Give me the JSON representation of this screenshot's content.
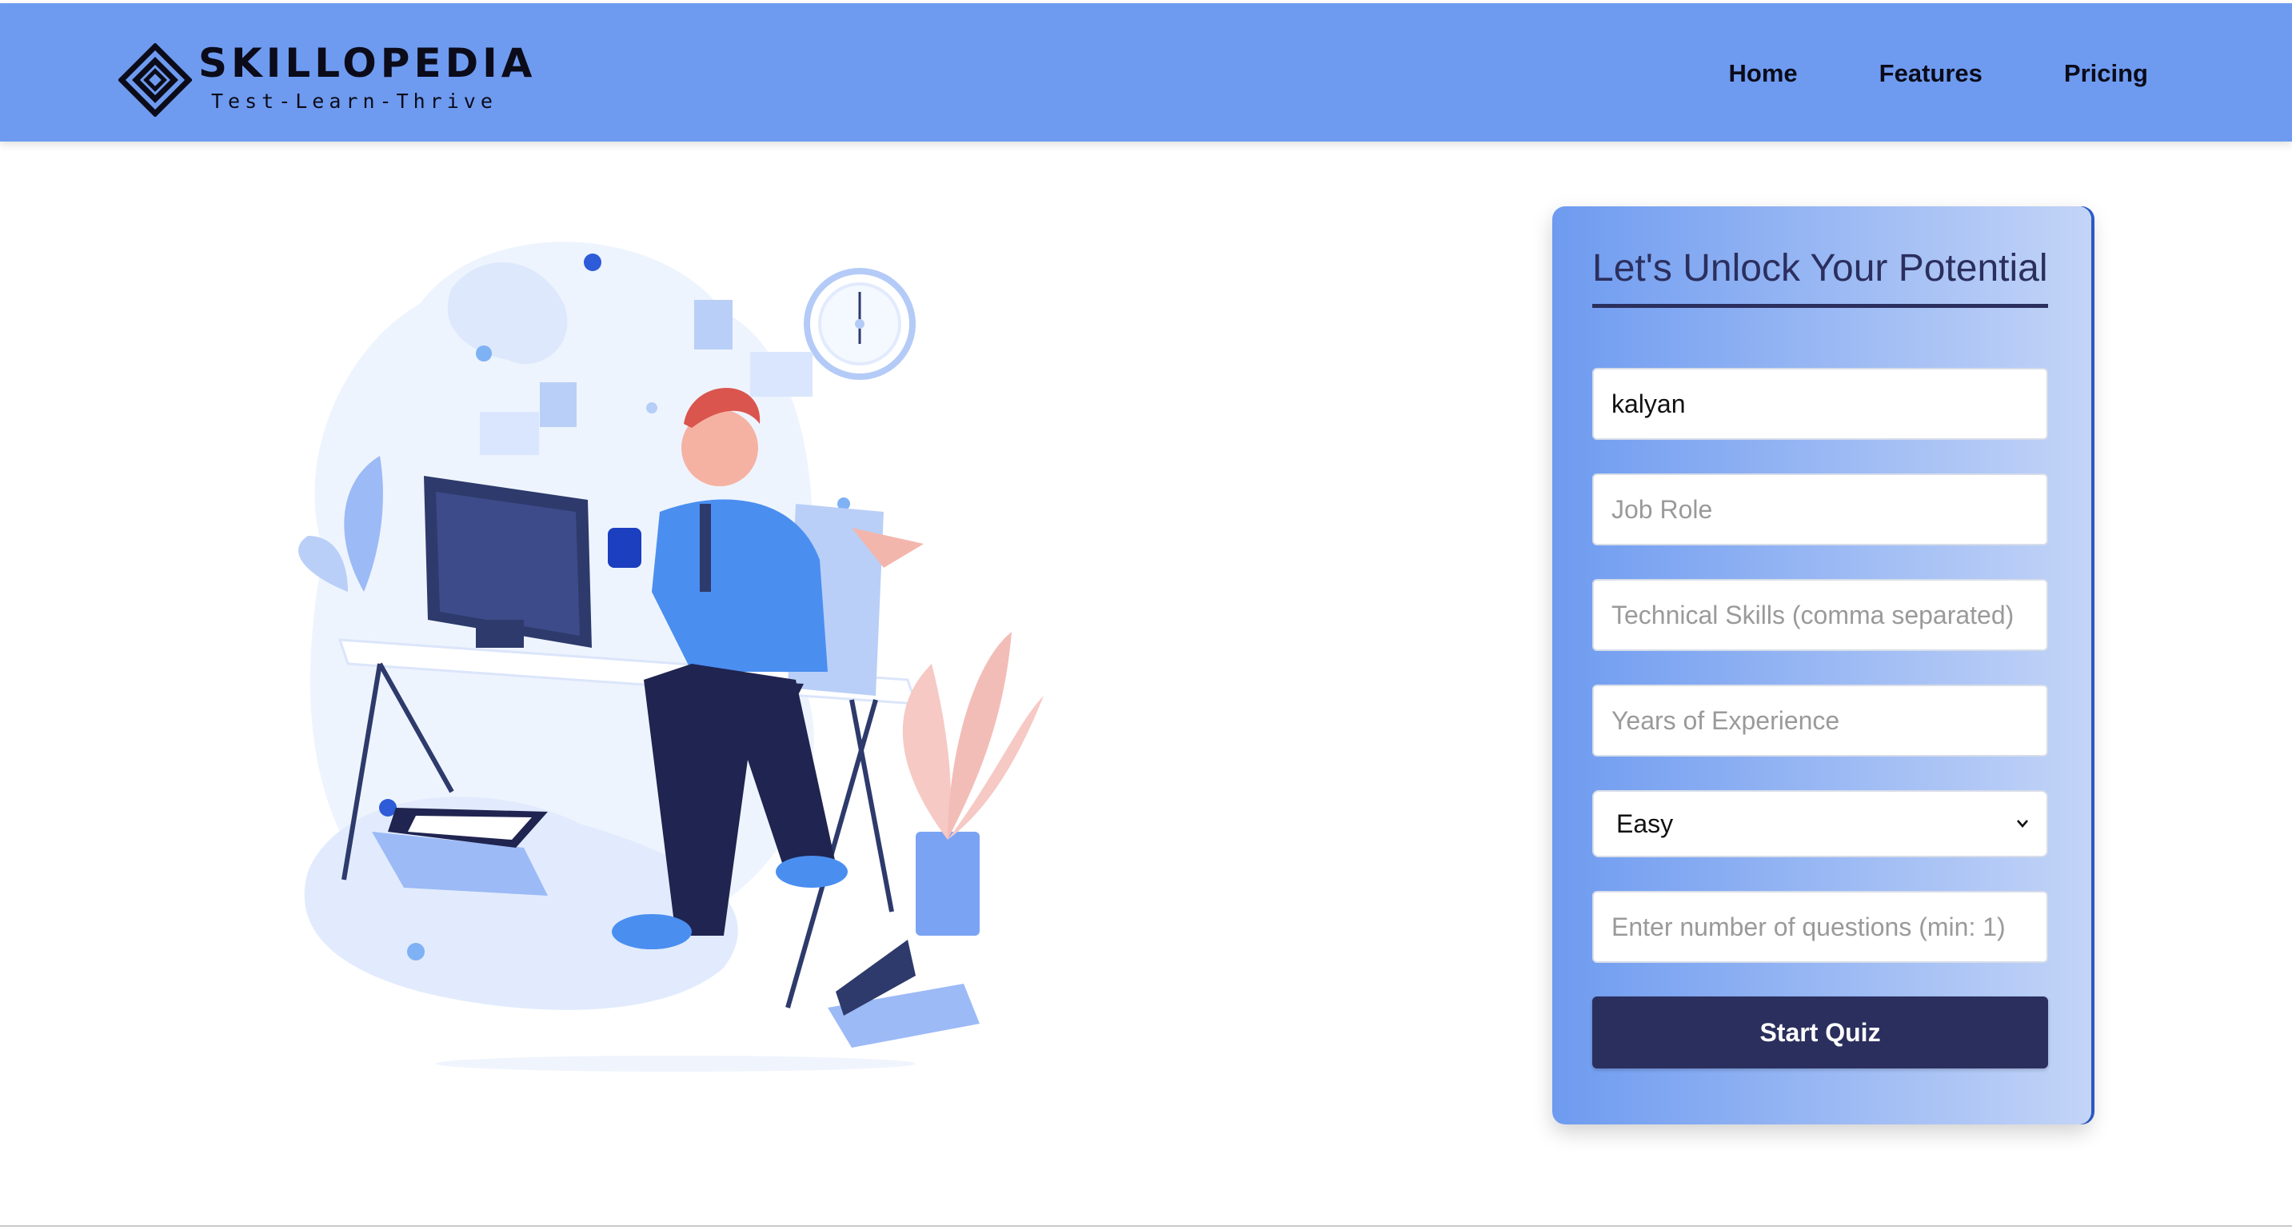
{
  "brand": {
    "name": "SKILLOPEDIA",
    "tagline": "Test-Learn-Thrive"
  },
  "nav": {
    "items": [
      {
        "label": "Home"
      },
      {
        "label": "Features"
      },
      {
        "label": "Pricing"
      }
    ]
  },
  "form": {
    "title": "Let's Unlock Your Potential",
    "name_value": "kalyan",
    "job_role_placeholder": "Job Role",
    "skills_placeholder": "Technical Skills (comma separated)",
    "experience_placeholder": "Years of Experience",
    "difficulty": {
      "selected": "Easy"
    },
    "questions_placeholder": "Enter number of questions (min: 1)",
    "submit_label": "Start Quiz"
  },
  "colors": {
    "header_bg": "#6e9bf0",
    "card_gradient_start": "#6e9bf0",
    "card_gradient_end": "#c3d4f7",
    "primary_dark": "#2b2f5e"
  }
}
